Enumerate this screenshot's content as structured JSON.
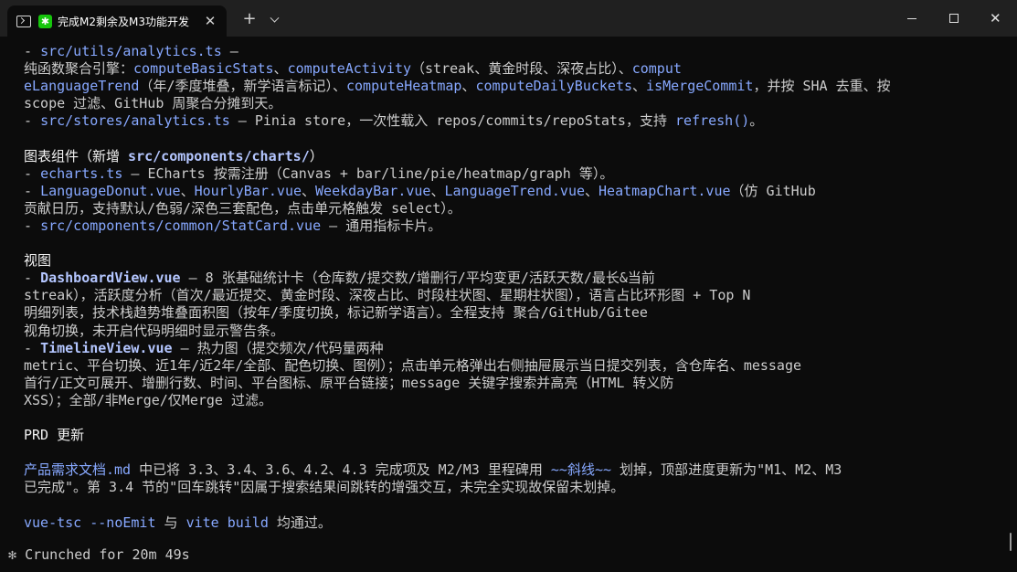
{
  "window": {
    "tab_title": "完成M2剩余及M3功能开发",
    "tab_status_icon": "✱",
    "tab_close_glyph": "✕",
    "new_tab_glyph": "+",
    "close_glyph": "✕"
  },
  "terminal": {
    "lines": [
      [
        {
          "t": "- ",
          "c": ""
        },
        {
          "t": "src/utils/analytics.ts",
          "c": "c-path"
        },
        {
          "t": " –",
          "c": ""
        }
      ],
      [
        {
          "t": "纯函数聚合引擎：",
          "c": ""
        },
        {
          "t": "computeBasicStats",
          "c": "c-path"
        },
        {
          "t": "、",
          "c": ""
        },
        {
          "t": "computeActivity",
          "c": "c-path"
        },
        {
          "t": "（streak、黄金时段、深夜占比）、",
          "c": ""
        },
        {
          "t": "comput",
          "c": "c-path"
        }
      ],
      [
        {
          "t": "eLanguageTrend",
          "c": "c-path"
        },
        {
          "t": "（年/季度堆叠，新学语言标记）、",
          "c": ""
        },
        {
          "t": "computeHeatmap",
          "c": "c-path"
        },
        {
          "t": "、",
          "c": ""
        },
        {
          "t": "computeDailyBuckets",
          "c": "c-path"
        },
        {
          "t": "、",
          "c": ""
        },
        {
          "t": "isMergeCommit",
          "c": "c-path"
        },
        {
          "t": "，并按 SHA 去重、按",
          "c": ""
        }
      ],
      [
        {
          "t": "scope 过滤、GitHub 周聚合分摊到天。",
          "c": ""
        }
      ],
      [
        {
          "t": "- ",
          "c": ""
        },
        {
          "t": "src/stores/analytics.ts",
          "c": "c-path"
        },
        {
          "t": " – Pinia store，一次性载入 repos/commits/repoStats，支持 ",
          "c": ""
        },
        {
          "t": "refresh()",
          "c": "c-path"
        },
        {
          "t": "。",
          "c": ""
        }
      ],
      [],
      [
        {
          "t": "图表组件（新增 ",
          "c": "c-bright"
        },
        {
          "t": "src/components/charts/",
          "c": "c-bold"
        },
        {
          "t": "）",
          "c": "c-bright"
        }
      ],
      [
        {
          "t": "- ",
          "c": ""
        },
        {
          "t": "echarts.ts",
          "c": "c-path"
        },
        {
          "t": " – ECharts 按需注册（Canvas + bar/line/pie/heatmap/graph 等）。",
          "c": ""
        }
      ],
      [
        {
          "t": "- ",
          "c": ""
        },
        {
          "t": "LanguageDonut.vue",
          "c": "c-path"
        },
        {
          "t": "、",
          "c": ""
        },
        {
          "t": "HourlyBar.vue",
          "c": "c-path"
        },
        {
          "t": "、",
          "c": ""
        },
        {
          "t": "WeekdayBar.vue",
          "c": "c-path"
        },
        {
          "t": "、",
          "c": ""
        },
        {
          "t": "LanguageTrend.vue",
          "c": "c-path"
        },
        {
          "t": "、",
          "c": ""
        },
        {
          "t": "HeatmapChart.vue",
          "c": "c-path"
        },
        {
          "t": "（仿 GitHub",
          "c": ""
        }
      ],
      [
        {
          "t": "贡献日历，支持默认/色弱/深色三套配色，点击单元格触发 select）。",
          "c": ""
        }
      ],
      [
        {
          "t": "- ",
          "c": ""
        },
        {
          "t": "src/components/common/StatCard.vue",
          "c": "c-path"
        },
        {
          "t": " – 通用指标卡片。",
          "c": ""
        }
      ],
      [],
      [
        {
          "t": "视图",
          "c": "c-bright"
        }
      ],
      [
        {
          "t": "- ",
          "c": ""
        },
        {
          "t": "DashboardView.vue",
          "c": "c-bold"
        },
        {
          "t": " – 8 张基础统计卡（仓库数/提交数/增删行/平均变更/活跃天数/最长&当前",
          "c": ""
        }
      ],
      [
        {
          "t": "streak），活跃度分析（首次/最近提交、黄金时段、深夜占比、时段柱状图、星期柱状图），语言占比环形图 + Top N",
          "c": ""
        }
      ],
      [
        {
          "t": "明细列表，技术栈趋势堆叠面积图（按年/季度切换，标记新学语言）。全程支持 聚合/GitHub/Gitee",
          "c": ""
        }
      ],
      [
        {
          "t": "视角切换，未开启代码明细时显示警告条。",
          "c": ""
        }
      ],
      [
        {
          "t": "- ",
          "c": ""
        },
        {
          "t": "TimelineView.vue",
          "c": "c-bold"
        },
        {
          "t": " – 热力图（提交频次/代码量两种",
          "c": ""
        }
      ],
      [
        {
          "t": "metric、平台切换、近1年/近2年/全部、配色切换、图例）；点击单元格弹出右侧抽屉展示当日提交列表，含仓库名、message",
          "c": ""
        }
      ],
      [
        {
          "t": "首行/正文可展开、增删行数、时间、平台图标、原平台链接；message 关键字搜索并高亮（HTML 转义防",
          "c": ""
        }
      ],
      [
        {
          "t": "XSS）；全部/非Merge/仅Merge 过滤。",
          "c": ""
        }
      ],
      [],
      [
        {
          "t": "PRD 更新",
          "c": "c-bright"
        }
      ],
      [],
      [
        {
          "t": "产品需求文档.md",
          "c": "c-path"
        },
        {
          "t": " 中已将 3.3、3.4、3.6、4.2、4.3 完成项及 M2/M3 里程碑用 ",
          "c": ""
        },
        {
          "t": "~~斜线~~",
          "c": "c-path"
        },
        {
          "t": " 划掉，顶部进度更新为\"M1、M2、M3",
          "c": ""
        }
      ],
      [
        {
          "t": "已完成\"。第 3.4 节的\"回车跳转\"因属于搜索结果间跳转的增强交互，未完全实现故保留未划掉。",
          "c": ""
        }
      ],
      [],
      [
        {
          "t": "vue-tsc --noEmit",
          "c": "c-path"
        },
        {
          "t": " 与 ",
          "c": ""
        },
        {
          "t": "vite build",
          "c": "c-path"
        },
        {
          "t": " 均通过。",
          "c": ""
        }
      ]
    ]
  },
  "status": {
    "icon": "✻",
    "text": "Crunched for 20m 49s"
  }
}
